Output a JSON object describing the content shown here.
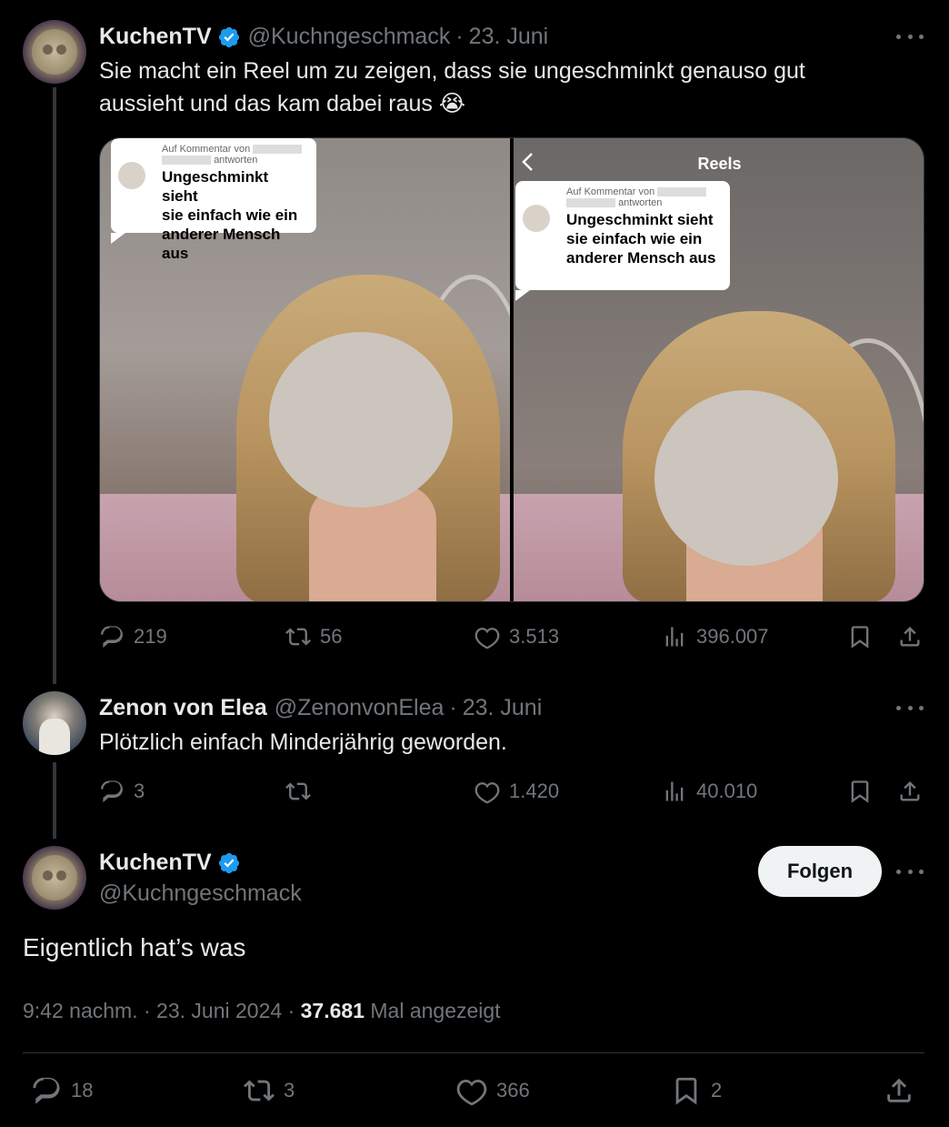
{
  "tweet1": {
    "name": "KuchenTV",
    "handle": "@Kuchngeschmack",
    "date": "23. Juni",
    "text_line1": "Sie macht ein Reel um zu zeigen, dass sie ungeschminkt genauso gut",
    "text_line2": "aussieht und das kam dabei raus 😭",
    "media": {
      "left_bubble": {
        "small_line1": "Auf Kommentar von",
        "small_line2": "antworten",
        "big_line1": "Ungeschminkt sieht",
        "big_line2": "sie einfach wie ein",
        "big_line3": "anderer Mensch aus"
      },
      "right_header": "Reels",
      "right_bubble": {
        "small_line1": "Auf Kommentar von",
        "small_line2": "antworten",
        "big_line1": "Ungeschminkt sieht",
        "big_line2": "sie einfach wie ein",
        "big_line3": "anderer Mensch aus"
      }
    },
    "replies": "219",
    "reposts": "56",
    "likes": "3.513",
    "views": "396.007"
  },
  "tweet2": {
    "name": "Zenon von Elea",
    "handle": "@ZenonvonElea",
    "date": "23. Juni",
    "text": "Plötzlich einfach Minderjährig geworden.",
    "replies": "3",
    "reposts": "",
    "likes": "1.420",
    "views": "40.010"
  },
  "main": {
    "name": "KuchenTV",
    "handle": "@Kuchngeschmack",
    "follow_label": "Folgen",
    "text": "Eigentlich hat’s was",
    "time": "9:42 nachm.",
    "date": "23. Juni 2024",
    "view_count": "37.681",
    "view_label": "Mal angezeigt",
    "replies": "18",
    "reposts": "3",
    "likes": "366",
    "bookmarks": "2"
  },
  "colors": {
    "background": "#000000",
    "text": "#e7e9ea",
    "muted": "#71767b",
    "verified": "#1d9bf0"
  }
}
